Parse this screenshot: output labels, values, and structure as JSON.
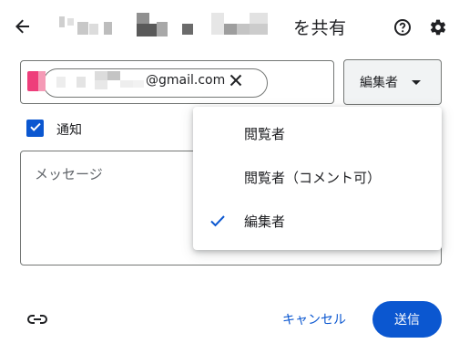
{
  "header": {
    "title_suffix": "を共有",
    "back_icon": "arrow-left-icon",
    "help_icon": "help-circle-icon",
    "settings_icon": "gear-icon"
  },
  "recipient": {
    "email_visible": "@gmail.com",
    "remove_icon": "close-icon"
  },
  "role": {
    "selected": "編集者"
  },
  "notify": {
    "label": "通知",
    "checked": true
  },
  "message": {
    "placeholder": "メッセージ"
  },
  "dropdown": {
    "items": [
      {
        "label": "閲覧者",
        "selected": false
      },
      {
        "label": "閲覧者（コメント可）",
        "selected": false
      },
      {
        "label": "編集者",
        "selected": true
      }
    ]
  },
  "footer": {
    "link_icon": "link-icon",
    "cancel_label": "キャンセル",
    "send_label": "送信"
  },
  "colors": {
    "accent": "#0b57d0",
    "avatar": "#ee3e7b"
  }
}
